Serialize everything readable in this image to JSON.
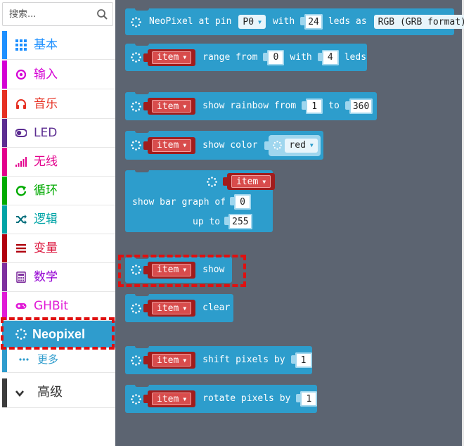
{
  "toolbox": {
    "search_placeholder": "搜索...",
    "categories": [
      {
        "label": "基本",
        "color": "#1e90ff",
        "icon": "grid-icon"
      },
      {
        "label": "输入",
        "color": "#d400d4",
        "icon": "target-icon"
      },
      {
        "label": "音乐",
        "color": "#e63022",
        "icon": "headphones-icon"
      },
      {
        "label": "LED",
        "color": "#5c2d91",
        "icon": "toggle-icon"
      },
      {
        "label": "无线",
        "color": "#e3008c",
        "icon": "signal-icon"
      },
      {
        "label": "循环",
        "color": "#00aa00",
        "icon": "refresh-icon"
      },
      {
        "label": "逻辑",
        "color": "#00a4a6",
        "icon": "shuffle-icon"
      },
      {
        "label": "变量",
        "color": "#dc143c",
        "icon": "list-icon"
      },
      {
        "label": "数学",
        "color": "#9400d3",
        "icon": "calculator-icon"
      },
      {
        "label": "GHBit",
        "color": "#e01ad6",
        "icon": "gamepad-icon"
      },
      {
        "label": "Neopixel",
        "color": "#2f9ccd",
        "icon": "neopixel-icon"
      }
    ],
    "more_label": "更多",
    "advanced_label": "高级"
  },
  "blocks": {
    "neopixel_at_pin": {
      "prefix": "NeoPixel at pin",
      "pin": "P0",
      "with": "with",
      "leds_count": "24",
      "leds_as": "leds as",
      "format": "RGB (GRB format)"
    },
    "range": {
      "var": "item",
      "range_from": "range from",
      "from": "0",
      "with": "with",
      "count": "4",
      "leds": "leds"
    },
    "show_rainbow": {
      "var": "item",
      "label": "show rainbow from",
      "from": "1",
      "to_label": "to",
      "to": "360"
    },
    "show_color": {
      "var": "item",
      "label": "show color",
      "color": "red"
    },
    "show_bar_graph": {
      "var": "item",
      "label": "show bar graph of",
      "value": "0",
      "up_to_label": "up to",
      "up_to": "255"
    },
    "show": {
      "var": "item",
      "label": "show"
    },
    "clear": {
      "var": "item",
      "label": "clear"
    },
    "shift": {
      "var": "item",
      "label": "shift pixels by",
      "value": "1"
    },
    "rotate": {
      "var": "item",
      "label": "rotate pixels by",
      "value": "1"
    }
  },
  "colors": {
    "block": "#2d9dcc",
    "variable": "#a11c1c",
    "workspace": "#5c6471",
    "highlight": "#e01010"
  }
}
